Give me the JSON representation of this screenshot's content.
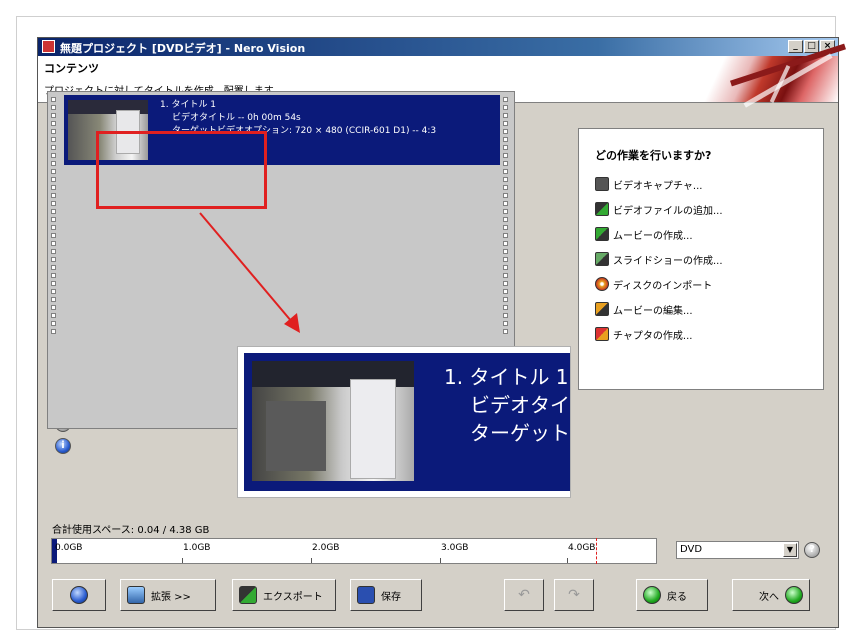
{
  "window": {
    "title": "無題プロジェクト [DVDビデオ] - Nero Vision",
    "controls": [
      "_",
      "□",
      "×"
    ]
  },
  "header": {
    "section": "コンテンツ",
    "description": "プロジェクトに対してタイトルを作成、配置します。"
  },
  "title_list": {
    "selected_row": {
      "line1": "1. タイトル 1",
      "line2": "ビデオタイトル -- 0h 00m 54s",
      "line3": "ターゲットビデオオプション: 720 × 480 (CCIR-601 D1) -- 4:3"
    }
  },
  "zoom_callout": {
    "line1": "1. タイトル 1",
    "line2": "ビデオタイト",
    "line3": "ターゲットビ"
  },
  "task_panel": {
    "title": "どの作業を行いますか?",
    "tasks": [
      {
        "label": "ビデオキャプチャ...",
        "icon": "camera-icon"
      },
      {
        "label": "ビデオファイルの追加...",
        "icon": "add-video-icon"
      },
      {
        "label": "ムービーの作成...",
        "icon": "create-movie-icon"
      },
      {
        "label": "スライドショーの作成...",
        "icon": "slideshow-icon"
      },
      {
        "label": "ディスクのインポート",
        "icon": "disc-import-icon"
      },
      {
        "label": "ムービーの編集...",
        "icon": "edit-movie-icon"
      },
      {
        "label": "チャプタの作成...",
        "icon": "chapter-icon"
      }
    ]
  },
  "disk_usage": {
    "label": "合計使用スペース: 0.04 / 4.38 GB",
    "used_gb": 0.04,
    "capacity_gb": 4.38,
    "ticks": [
      "0.0GB",
      "1.0GB",
      "2.0GB",
      "3.0GB",
      "4.0GB"
    ],
    "disc_type": "DVD"
  },
  "toolbar": {
    "expand": "拡張 >>",
    "export": "エクスポート",
    "save": "保存",
    "back": "戻る",
    "next": "次へ"
  },
  "colors": {
    "selection": "#0b1a7a",
    "highlight": "#e02020",
    "titlebar": "#0a246a"
  }
}
